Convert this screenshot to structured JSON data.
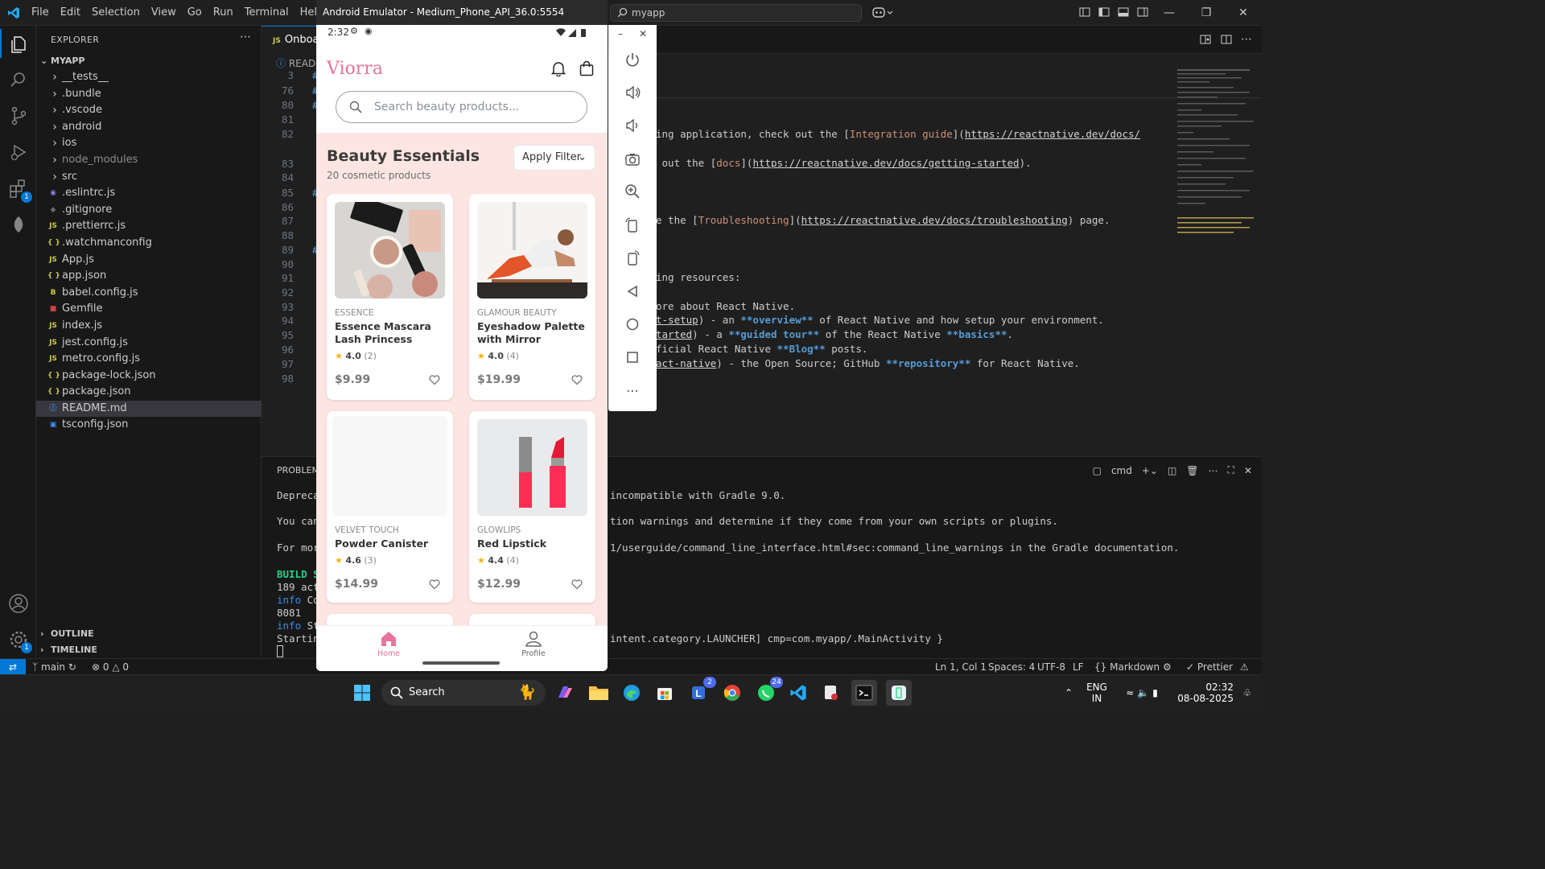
{
  "titlebar": {
    "menu": [
      "File",
      "Edit",
      "Selection",
      "View",
      "Go",
      "Run",
      "Terminal",
      "Help"
    ],
    "search": "myapp"
  },
  "sidebar": {
    "title": "EXPLORER",
    "root": "MYAPP",
    "items": [
      {
        "label": "__tests__",
        "type": "folder"
      },
      {
        "label": ".bundle",
        "type": "folder"
      },
      {
        "label": ".vscode",
        "type": "folder"
      },
      {
        "label": "android",
        "type": "folder"
      },
      {
        "label": "ios",
        "type": "folder"
      },
      {
        "label": "node_modules",
        "type": "folder"
      },
      {
        "label": "src",
        "type": "folder"
      },
      {
        "label": ".eslintrc.js",
        "type": "eslint"
      },
      {
        "label": ".gitignore",
        "type": "git"
      },
      {
        "label": ".prettierrc.js",
        "type": "js"
      },
      {
        "label": ".watchmanconfig",
        "type": "json"
      },
      {
        "label": "App.js",
        "type": "js"
      },
      {
        "label": "app.json",
        "type": "json"
      },
      {
        "label": "babel.config.js",
        "type": "babel"
      },
      {
        "label": "Gemfile",
        "type": "gem"
      },
      {
        "label": "index.js",
        "type": "js"
      },
      {
        "label": "jest.config.js",
        "type": "js"
      },
      {
        "label": "metro.config.js",
        "type": "js"
      },
      {
        "label": "package-lock.json",
        "type": "json"
      },
      {
        "label": "package.json",
        "type": "json"
      },
      {
        "label": "README.md",
        "type": "info"
      },
      {
        "label": "tsconfig.json",
        "type": "ts"
      }
    ],
    "outline": "OUTLINE",
    "timeline": "TIMELINE"
  },
  "editor": {
    "tab_label": "Onboa",
    "breadcrumb": "READM",
    "line_numbers": [
      "3",
      "76",
      "80",
      "81",
      "82",
      "83",
      "84",
      "85",
      "86",
      "87",
      "88",
      "89",
      "90",
      "91",
      "92",
      "93",
      "94",
      "95",
      "96",
      "97",
      "98"
    ],
    "code": {
      "l82_a": "ing application, check out the [",
      "l82_b": "Integration guide",
      "l82_c": "](",
      "l82_d": "https://reactnative.dev/docs/",
      "l83_a": " out the [",
      "l83_b": "docs",
      "l83_c": "](",
      "l83_d": "https://reactnative.dev/docs/getting-started",
      "l83_e": ").",
      "l87_a": "e the [",
      "l87_b": "Troubleshooting",
      "l87_c": "](",
      "l87_d": "https://reactnative.dev/docs/troubleshooting",
      "l87_e": ") page.",
      "l91": "ing resources:",
      "l93": "ore about React Native.",
      "l94_a": "t-setup",
      "l94_b": ") - an ",
      "l94_c": "**overview**",
      "l94_d": " of React Native and how setup your environment.",
      "l95_a": "tarted",
      "l95_b": ") - a ",
      "l95_c": "**guided tour**",
      "l95_d": " of the React Native ",
      "l95_e": "**basics**",
      "l95_f": ".",
      "l96_a": "ficial React Native ",
      "l96_b": "**Blog**",
      "l96_c": " posts.",
      "l97_a": "act-native",
      "l97_b": ") - the Open Source; GitHub ",
      "l97_c": "**repository**",
      "l97_d": " for React Native."
    }
  },
  "panel": {
    "tab": "PROBLEMS",
    "shell": "cmd",
    "lines": {
      "deprec_left": "Deprecat",
      "deprec_right": "incompatible with Gradle 9.0.",
      "can_left": "You can",
      "can_right": "tion warnings and determine if they come from your own scripts or plugins.",
      "more_left": "For more",
      "more_right": "1/userguide/command_line_interface.html#sec:command_line_warnings in the Gradle documentation.",
      "build": "BUILD SU",
      "actions": "189 acti",
      "info1_a": "info",
      "info1_b": " Co",
      "port": "8081",
      "info2_a": "info",
      "info2_b": " St",
      "starting": "Starting",
      "launcher": "intent.category.LAUNCHER] cmp=com.myapp/.MainActivity }"
    }
  },
  "statusbar": {
    "branch": "main",
    "errors": "0",
    "warnings": "0",
    "position": "Ln 1, Col 1",
    "spaces": "Spaces: 4",
    "encoding": "UTF-8",
    "eol": "LF",
    "language": "Markdown",
    "prettier": "Prettier"
  },
  "emulator": {
    "title": "Android Emulator - Medium_Phone_API_36.0:5554",
    "time": "2:32",
    "app": {
      "brand": "Viorra",
      "search_placeholder": "Search beauty products...",
      "section_title": "Beauty Essentials",
      "section_sub": "20 cosmetic products",
      "filter": "Apply Filter",
      "products": [
        {
          "brand": "ESSENCE",
          "name": "Essence Mascara Lash Princess",
          "rating": "4.0",
          "count": "(2)",
          "price": "$9.99"
        },
        {
          "brand": "GLAMOUR BEAUTY",
          "name": "Eyeshadow Palette with Mirror",
          "rating": "4.0",
          "count": "(4)",
          "price": "$19.99"
        },
        {
          "brand": "VELVET TOUCH",
          "name": "Powder Canister",
          "rating": "4.6",
          "count": "(3)",
          "price": "$14.99"
        },
        {
          "brand": "GLOWLIPS",
          "name": "Red Lipstick",
          "rating": "4.4",
          "count": "(4)",
          "price": "$12.99"
        }
      ],
      "nav": {
        "home": "Home",
        "profile": "Profile"
      }
    }
  },
  "taskbar": {
    "search": "Search",
    "badges": {
      "teams": "2",
      "whatsapp": "24"
    },
    "lang_top": "ENG",
    "lang_bottom": "IN",
    "time": "02:32",
    "date": "08-08-2025"
  },
  "colors": {
    "accent": "#0078d4",
    "brand_pink": "#e8739b",
    "content_bg": "#fde6e2"
  }
}
